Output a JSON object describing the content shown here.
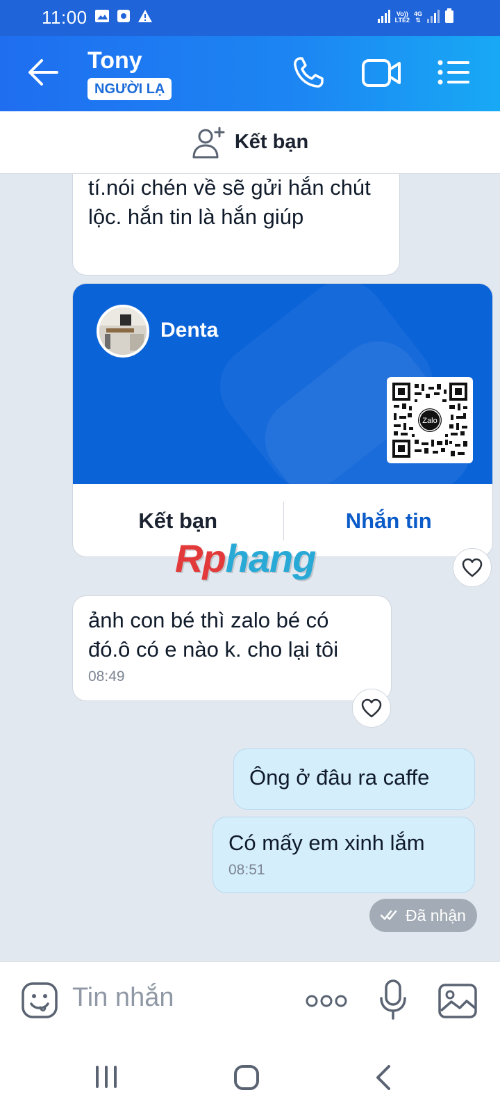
{
  "status_bar": {
    "time": "11:00",
    "net_label_top": "Vo))",
    "net_label_bottom": "LTE2",
    "data_label": "4G"
  },
  "header": {
    "contact_name": "Tony",
    "contact_tag": "NGƯỜI LẠ",
    "icons": [
      "back-arrow-icon",
      "phone-icon",
      "video-call-icon",
      "menu-icon"
    ]
  },
  "add_friend_bar": {
    "label": "Kết bạn"
  },
  "messages": {
    "m1_text": "tí.nói chén về sẽ gửi hắn chút lộc. hắn tin là hắn giúp",
    "card": {
      "name": "Denta",
      "qr_brand": "Zalo",
      "add_friend_label": "Kết bạn",
      "message_label": "Nhắn tin"
    },
    "m2_text": "ảnh con bé thì zalo bé có đó.ô có e nào k. cho lại tôi",
    "m2_time": "08:49",
    "m3_text": "Ông ở đâu ra caffe",
    "m4_text": "Có mấy em xinh lắm",
    "m4_time": "08:51",
    "receipt": "Đã nhận"
  },
  "watermark": {
    "part1": "Rp",
    "part2": "hang"
  },
  "input_bar": {
    "placeholder": "Tin nhắn"
  },
  "colors": {
    "header_blue": "#1f6ef0",
    "card_blue": "#0b63d8",
    "outgoing_bubble": "#d5eefb",
    "link_blue": "#0b5bc8"
  }
}
